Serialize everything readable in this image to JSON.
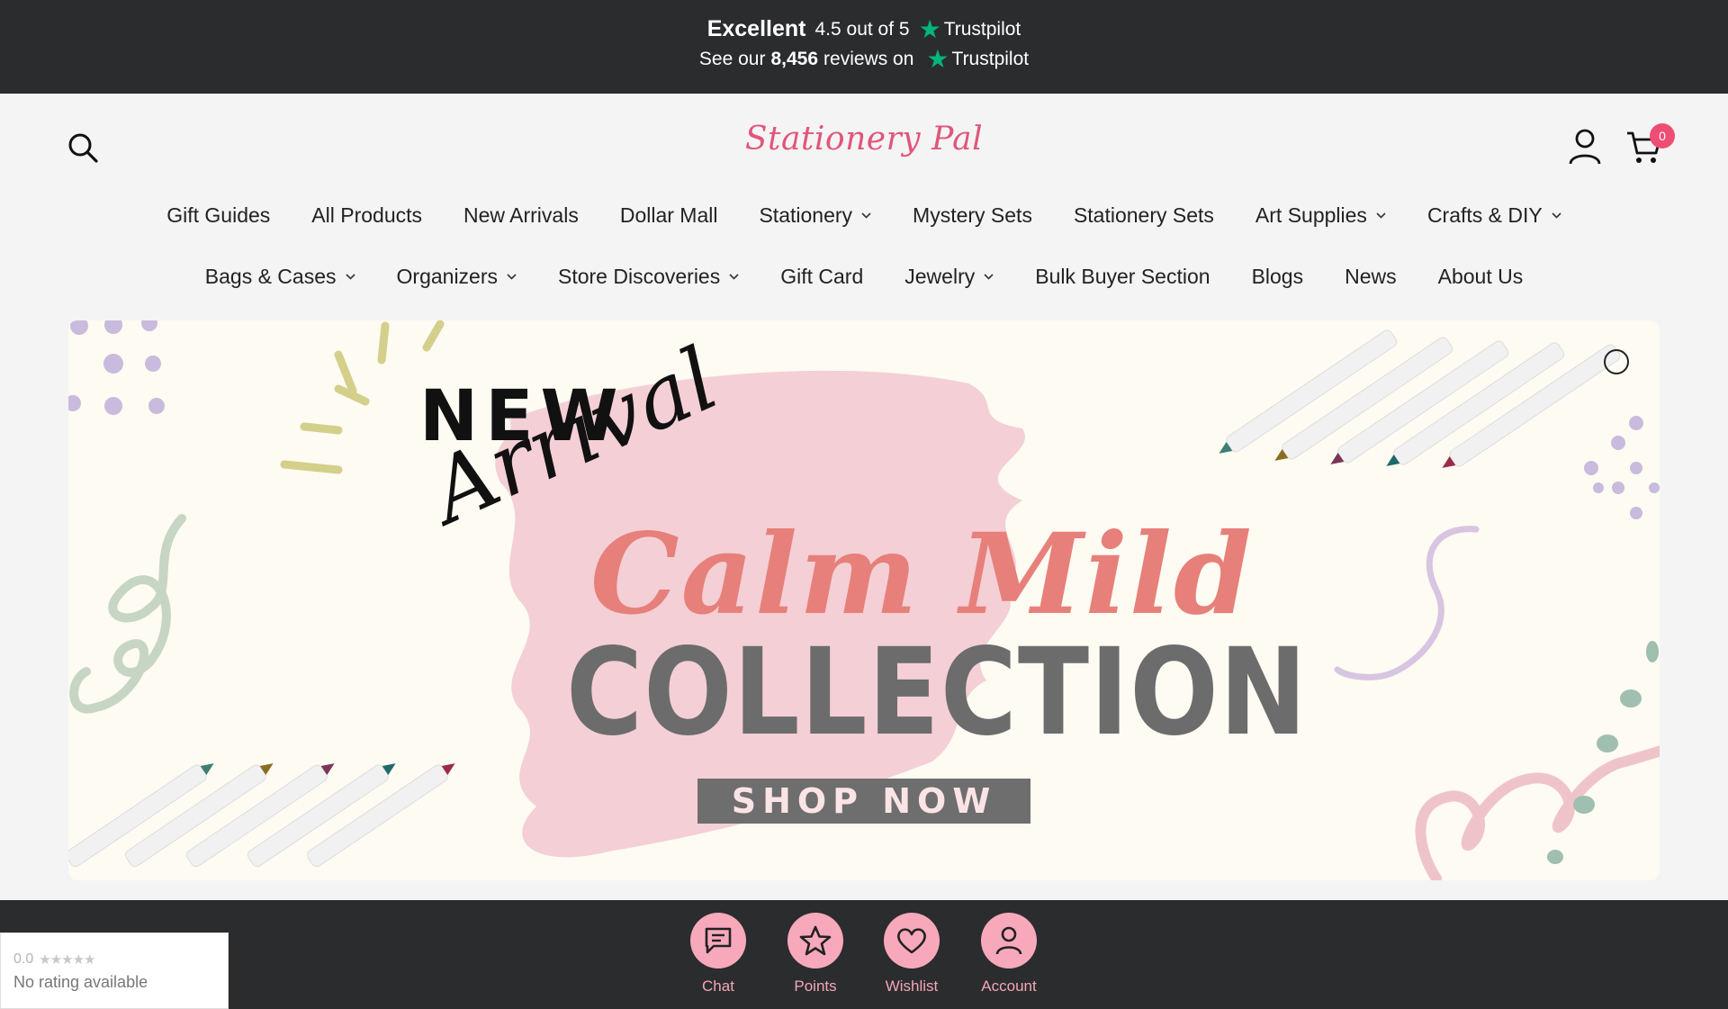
{
  "trustpilot": {
    "rating_word": "Excellent",
    "score_text": "4.5 out of 5",
    "brand": "Trustpilot",
    "reviews_prefix": "See our",
    "reviews_count": "8,456",
    "reviews_suffix": "reviews on",
    "brand2": "Trustpilot",
    "star_color": "#00b67a"
  },
  "header": {
    "logo": "Stationery Pal",
    "cart_count": "0",
    "logo_color": "#e0567a"
  },
  "nav": {
    "row1": [
      {
        "label": "Gift Guides",
        "dropdown": false
      },
      {
        "label": "All Products",
        "dropdown": false
      },
      {
        "label": "New Arrivals",
        "dropdown": false
      },
      {
        "label": "Dollar Mall",
        "dropdown": false
      },
      {
        "label": "Stationery",
        "dropdown": true
      },
      {
        "label": "Mystery Sets",
        "dropdown": false
      },
      {
        "label": "Stationery Sets",
        "dropdown": false
      },
      {
        "label": "Art Supplies",
        "dropdown": true
      },
      {
        "label": "Crafts & DIY",
        "dropdown": true
      }
    ],
    "row2": [
      {
        "label": "Bags & Cases",
        "dropdown": true
      },
      {
        "label": "Organizers",
        "dropdown": true
      },
      {
        "label": "Store Discoveries",
        "dropdown": true
      },
      {
        "label": "Gift Card",
        "dropdown": false
      },
      {
        "label": "Jewelry",
        "dropdown": true
      },
      {
        "label": "Bulk Buyer Section",
        "dropdown": false
      },
      {
        "label": "Blogs",
        "dropdown": false
      },
      {
        "label": "News",
        "dropdown": false
      },
      {
        "label": "About Us",
        "dropdown": false
      }
    ]
  },
  "hero": {
    "new": "NEW",
    "arrival": "Arrival",
    "calm_mild": "Calm Mild",
    "collection": "COLLECTION",
    "cta": "SHOP NOW"
  },
  "bottom_bar": {
    "chat": "Chat",
    "points": "Points",
    "wishlist": "Wishlist",
    "account": "Account",
    "accent": "#f7a9bb"
  },
  "rating_widget": {
    "score": "0.0",
    "stars": "★★★★★",
    "text": "No rating available"
  }
}
